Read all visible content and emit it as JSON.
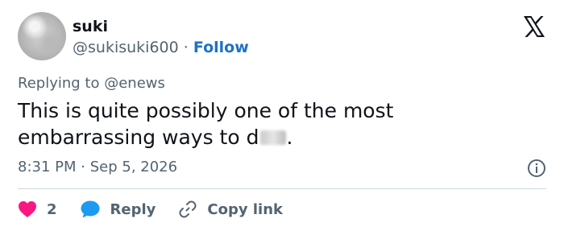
{
  "author": {
    "name": "suki",
    "handle": "@sukisuki600",
    "separator": "·",
    "follow_label": "Follow"
  },
  "reply_context": {
    "prefix": "Replying to",
    "mention": "@enews"
  },
  "tweet": {
    "line1": "This is quite possibly one of the most",
    "line2_start": "embarrassing ways to d",
    "line2_end": "."
  },
  "meta": {
    "time": "8:31 PM",
    "separator": "·",
    "date": "Sep 5, 2026"
  },
  "actions": {
    "like_count": "2",
    "reply_label": "Reply",
    "copy_label": "Copy link"
  },
  "colors": {
    "like": "#f91880",
    "reply_icon": "#1d9bf0",
    "follow": "#1d72c8",
    "muted": "#536471"
  },
  "icons": [
    "x-logo-icon",
    "info-icon",
    "heart-icon",
    "reply-bubble-icon",
    "link-icon"
  ]
}
